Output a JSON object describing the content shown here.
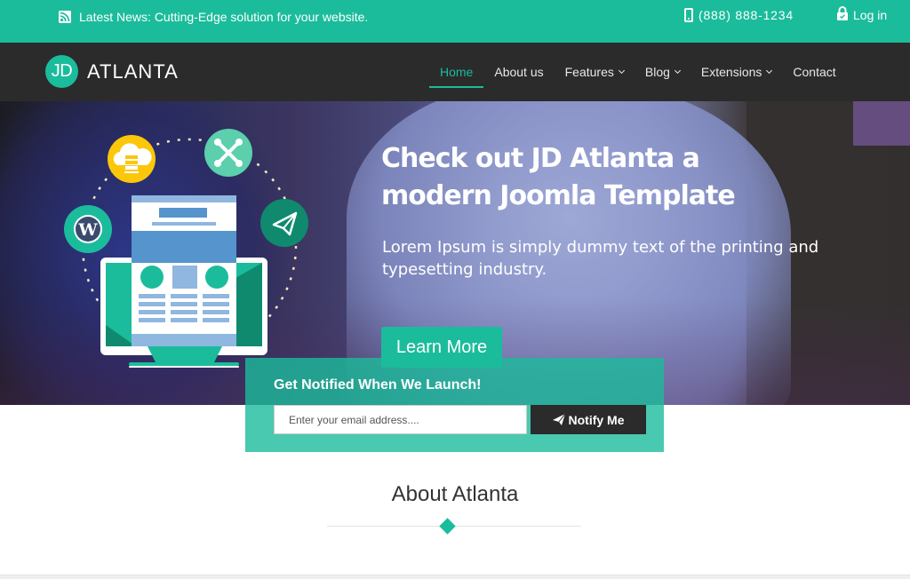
{
  "topbar": {
    "news_icon": "rss-icon",
    "news_text": "Latest News: Cutting-Edge solution for your website.",
    "phone_icon": "mobile-phone-icon",
    "phone": "(888) 888-1234",
    "login_icon": "lock-icon",
    "login_label": "Log in"
  },
  "logo": {
    "badge": "JD",
    "name": "ATLANTA"
  },
  "nav": {
    "items": [
      {
        "label": "Home",
        "active": true,
        "dropdown": false
      },
      {
        "label": "About us",
        "active": false,
        "dropdown": false
      },
      {
        "label": "Features",
        "active": false,
        "dropdown": true
      },
      {
        "label": "Blog",
        "active": false,
        "dropdown": true
      },
      {
        "label": "Extensions",
        "active": false,
        "dropdown": true
      },
      {
        "label": "Contact",
        "active": false,
        "dropdown": false
      }
    ]
  },
  "hero": {
    "title": "Check out JD Atlanta a modern Joomla Template",
    "subtitle": "Lorem Ipsum is simply dummy text of the printing and typesetting industry.",
    "cta_label": "Learn More",
    "illustration_icons": [
      "cloud-server-icon",
      "joomla-icon",
      "wordpress-icon",
      "paper-plane-icon",
      "monitor-website-icon"
    ]
  },
  "notify": {
    "title": "Get Notified When We Launch!",
    "email_placeholder": "Enter your email address....",
    "email_value": "",
    "button_label": "Notify Me",
    "button_icon": "paper-plane-icon"
  },
  "about": {
    "title": "About Atlanta"
  },
  "colors": {
    "accent": "#1bbc9b",
    "nav_bg": "#2b2b2b",
    "text_dark": "#333333"
  }
}
